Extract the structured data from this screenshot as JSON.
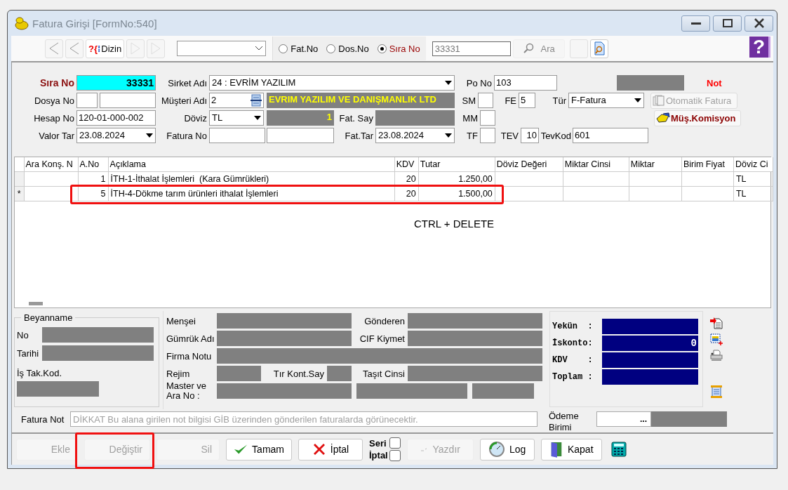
{
  "window": {
    "title": "Fatura Girişi [FormNo:540]"
  },
  "toolbar": {
    "nav": [
      {
        "kind": "first",
        "disabled": false
      },
      {
        "kind": "prev",
        "disabled": false
      },
      {
        "kind": "next",
        "disabled": true
      },
      {
        "kind": "last",
        "disabled": true
      }
    ],
    "dizin_button": "Dizin",
    "dizin_glyphs": [
      "?{",
      "⁞"
    ],
    "help_button": "?",
    "search_modes": [
      {
        "label": "Fat.No",
        "selected": false
      },
      {
        "label": "Dos.No",
        "selected": false
      },
      {
        "label": "Sıra No",
        "selected": true
      }
    ],
    "search_value": "33331",
    "search_button": "Ara"
  },
  "form": {
    "sira_no": {
      "label": "Sıra No",
      "value": "33331"
    },
    "sirket_adi": {
      "label": "Sirket Adı",
      "value": "24 : EVRİM YAZILIM"
    },
    "po_no": {
      "label": "Po No",
      "value": "103"
    },
    "not_label": "Not",
    "dosya_no": {
      "label": "Dosya No"
    },
    "musteri_adi": {
      "label": "Müşteri Adı",
      "value": "2",
      "name": "EVRIM YAZILIM VE DANIŞMANLIK LTD"
    },
    "sm": {
      "label": "SM"
    },
    "fe": {
      "label": "FE",
      "value": "5"
    },
    "tur": {
      "label": "Tür",
      "value": "F-Fatura"
    },
    "hesap_no": {
      "label": "Hesap No",
      "value": "120-01-000-002"
    },
    "doviz": {
      "label": "Döviz",
      "value": "TL",
      "rate": "1"
    },
    "fat_say": {
      "label": "Fat. Say"
    },
    "mm": {
      "label": "MM"
    },
    "valor_tar": {
      "label": "Valor Tar",
      "value": "23.08.2024"
    },
    "fatura_no": {
      "label": "Fatura No"
    },
    "fat_tar": {
      "label": "Fat.Tar",
      "value": "23.08.2024"
    },
    "tf": {
      "label": "TF"
    },
    "tev": {
      "label": "TEV",
      "value": "10"
    },
    "tev_kod": {
      "label": "TevKod",
      "value": "601"
    }
  },
  "side_buttons": [
    {
      "label": "Otomatik Fatura",
      "disabled": true
    },
    {
      "label": "Müş.Komisyon",
      "disabled": false
    }
  ],
  "table": {
    "columns": [
      {
        "label": "Ara Konş. N",
        "kind": "text"
      },
      {
        "label": "A.No",
        "kind": "number"
      },
      {
        "label": "Açıklama",
        "kind": "text"
      },
      {
        "label": "KDV",
        "kind": "number"
      },
      {
        "label": "Tutar",
        "kind": "number"
      },
      {
        "label": "Döviz Değeri",
        "kind": "text"
      },
      {
        "label": "Miktar Cinsi",
        "kind": "text"
      },
      {
        "label": "Miktar",
        "kind": "text"
      },
      {
        "label": "Birim Fiyat",
        "kind": "text"
      },
      {
        "label": "Döviz Ci",
        "kind": "text"
      }
    ],
    "rows": [
      {
        "marker": "",
        "highlighted": false,
        "cells": [
          "",
          "1",
          "İTH-1-İthalat İşlemleri  (Kara Gümrükleri)",
          "20",
          "1.250,00",
          "",
          "",
          "",
          "",
          "TL"
        ]
      },
      {
        "marker": "*",
        "highlighted": true,
        "cells": [
          "",
          "5",
          "İTH-4-Dökme tarım ürünleri ithalat İşlemleri",
          "20",
          "1.500,00",
          "",
          "",
          "",
          "",
          "TL"
        ]
      }
    ]
  },
  "annotation": "CTRL + DELETE",
  "beyanname": {
    "title": "Beyanname",
    "no": "No",
    "tarihi": "Tarihi",
    "is_tak_kod": "İş Tak.Kod."
  },
  "customs": {
    "mensei": "Menşei",
    "gonderen": "Gönderen",
    "gumruk_adi": "Gümrük Adı",
    "cif_kiymet": "CIF Kiymet",
    "firma_notu": "Firma Notu",
    "rejim": "Rejim",
    "tir_kont_say": "Tır Kont.Say",
    "tasit_cinsi": "Taşıt Cinsi",
    "master_ara_no": "Master ve Ara No :"
  },
  "totals": [
    {
      "label": "Yekün  :"
    },
    {
      "label": "İskonto:",
      "value": "0"
    },
    {
      "label": "KDV    :"
    },
    {
      "label": "Toplam :"
    }
  ],
  "fatura_not": {
    "label": "Fatura Not",
    "placeholder": "DİKKAT Bu alana girilen not bilgisi GİB üzerinden gönderilen faturalarda görünecektir."
  },
  "odeme_birimi": {
    "label": "Ödeme Birimi",
    "button": "..."
  },
  "buttons": [
    {
      "kind": "ekle",
      "label": "Ekle",
      "disabled": true,
      "highlighted": false
    },
    {
      "kind": "degistir",
      "label": "Değiştir",
      "disabled": true,
      "highlighted": true
    },
    {
      "kind": "sil",
      "label": "Sil",
      "disabled": true,
      "highlighted": false
    },
    {
      "kind": "tamam",
      "label": "Tamam",
      "disabled": false,
      "highlighted": false
    },
    {
      "kind": "iptal",
      "label": "İptal",
      "disabled": false,
      "highlighted": false
    },
    {
      "kind": "seri",
      "options": [
        {
          "label": "Seri",
          "checked": false
        },
        {
          "label": "İptal",
          "checked": false
        }
      ]
    },
    {
      "kind": "yazdir",
      "label": "Yazdır",
      "disabled": true,
      "highlighted": false
    },
    {
      "kind": "log",
      "label": "Log",
      "disabled": false,
      "highlighted": false
    },
    {
      "kind": "kapat",
      "label": "Kapat",
      "disabled": false,
      "highlighted": false
    },
    {
      "kind": "calc"
    }
  ]
}
